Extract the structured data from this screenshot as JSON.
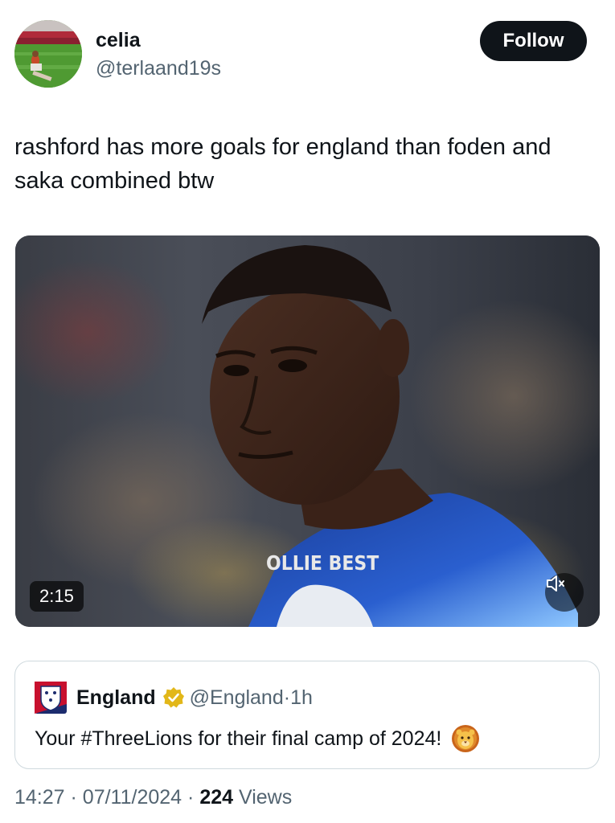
{
  "author": {
    "display_name": "celia",
    "handle": "@terlaand19s",
    "follow_label": "Follow",
    "avatar_icon": "stadium-photo-avatar"
  },
  "tweet": {
    "text": "rashford has more goals for england than foden and saka combined btw"
  },
  "media": {
    "duration": "2:15",
    "watermark": "OLLIE BEST",
    "mute_icon": "speaker-muted-icon"
  },
  "quoted": {
    "name": "England",
    "handle": "@England",
    "separator": "·",
    "time": "1h",
    "text": "Your #ThreeLions for their final camp of 2024!",
    "verified_color": "#e2b719",
    "emoji": "lion-face"
  },
  "meta": {
    "time": "14:27",
    "sep1": "·",
    "date": "07/11/2024",
    "sep2": "·",
    "views_count": "224",
    "views_label": "Views"
  }
}
